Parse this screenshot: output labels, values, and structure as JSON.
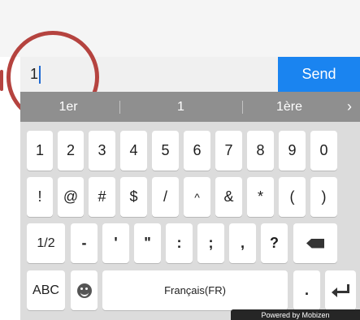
{
  "input": {
    "value": "1"
  },
  "send": {
    "label": "Send"
  },
  "suggestions": {
    "items": [
      "1er",
      "1",
      "1ère"
    ],
    "more": "›"
  },
  "keyboard": {
    "row1": [
      "1",
      "2",
      "3",
      "4",
      "5",
      "6",
      "7",
      "8",
      "9",
      "0"
    ],
    "row2": [
      "!",
      "@",
      "#",
      "$",
      "/",
      "^",
      "&",
      "*",
      "(",
      ")"
    ],
    "row3": [
      "1/2",
      "-",
      "'",
      "\"",
      ":",
      ";",
      ",",
      "?"
    ],
    "abc": "ABC",
    "space": "Français(FR)",
    "period": "."
  },
  "footer": {
    "powered": "Powered by Mobizen"
  },
  "colors": {
    "accent": "#1a84f0",
    "annotation": "#b5433f",
    "suggestion_bar": "#8f8f8f"
  }
}
